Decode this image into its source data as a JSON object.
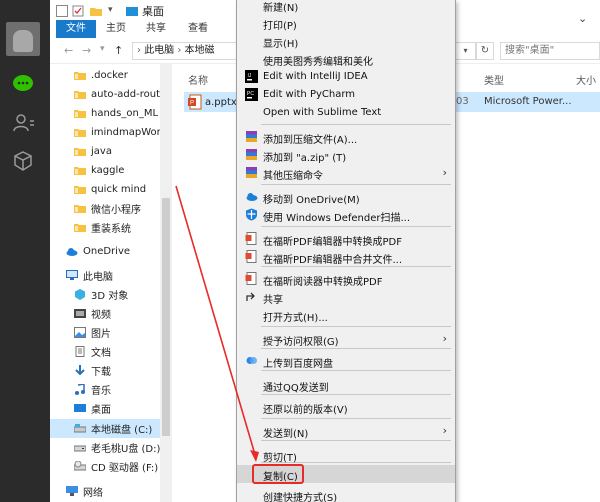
{
  "explorer": {
    "title": "桌面",
    "ribbon_tabs": {
      "file": "文件",
      "home": "主页",
      "share": "共享",
      "view": "查看"
    },
    "breadcrumb": [
      "此电脑",
      "本地磁"
    ],
    "search_placeholder": "搜索\"桌面\"",
    "columns": {
      "name": "名称",
      "type": "类型",
      "size": "大小"
    },
    "nav_items": [
      {
        "label": ".docker",
        "icon": "folder-icon"
      },
      {
        "label": "auto-add-route",
        "icon": "folder-icon"
      },
      {
        "label": "hands_on_ML",
        "icon": "folder-icon"
      },
      {
        "label": "imindmapWork",
        "icon": "folder-icon"
      },
      {
        "label": "java",
        "icon": "folder-icon"
      },
      {
        "label": "kaggle",
        "icon": "folder-icon"
      },
      {
        "label": "quick mind",
        "icon": "folder-icon"
      },
      {
        "label": "微信小程序",
        "icon": "folder-icon"
      },
      {
        "label": "重装系统",
        "icon": "folder-icon"
      },
      {
        "label": "OneDrive",
        "icon": "cloud-icon"
      },
      {
        "label": "此电脑",
        "icon": "computer-icon"
      },
      {
        "label": "3D 对象",
        "icon": "cube-icon"
      },
      {
        "label": "视频",
        "icon": "video-icon"
      },
      {
        "label": "图片",
        "icon": "picture-icon"
      },
      {
        "label": "文档",
        "icon": "document-icon"
      },
      {
        "label": "下载",
        "icon": "download-icon"
      },
      {
        "label": "音乐",
        "icon": "music-icon"
      },
      {
        "label": "桌面",
        "icon": "desktop-icon"
      },
      {
        "label": "本地磁盘 (C:)",
        "icon": "drive-icon"
      },
      {
        "label": "老毛桃U盘 (D:)",
        "icon": "usb-drive-icon"
      },
      {
        "label": "CD 驱动器 (F:)",
        "icon": "cd-drive-icon"
      },
      {
        "label": "网络",
        "icon": "network-icon"
      }
    ],
    "file": {
      "name": "a.pptx",
      "date_fragment": "03",
      "type": "Microsoft Power..."
    }
  },
  "context_menu": {
    "items": [
      {
        "label": "新建(N)",
        "icon": ""
      },
      {
        "label": "打印(P)",
        "icon": ""
      },
      {
        "label": "显示(H)",
        "icon": ""
      },
      {
        "label": "使用美图秀秀编辑和美化",
        "icon": ""
      },
      {
        "label": "Edit with IntelliJ IDEA",
        "icon": "intellij-icon"
      },
      {
        "label": "Edit with PyCharm",
        "icon": "pycharm-icon"
      },
      {
        "label": "Open with Sublime Text",
        "icon": ""
      },
      {
        "label": "添加到压缩文件(A)...",
        "icon": "winrar-icon"
      },
      {
        "label": "添加到 \"a.zip\" (T)",
        "icon": "winrar-icon"
      },
      {
        "label": "其他压缩命令",
        "icon": "winrar-icon",
        "submenu": true
      },
      {
        "label": "移动到 OneDrive(M)",
        "icon": "onedrive-icon"
      },
      {
        "label": "使用 Windows Defender扫描...",
        "icon": "defender-icon"
      },
      {
        "label": "在福昕PDF编辑器中转换成PDF",
        "icon": "foxit-icon"
      },
      {
        "label": "在福昕PDF编辑器中合并文件...",
        "icon": "foxit-icon"
      },
      {
        "label": "在福昕阅读器中转换成PDF",
        "icon": "foxit-icon"
      },
      {
        "label": "共享",
        "icon": "share-icon"
      },
      {
        "label": "打开方式(H)...",
        "icon": ""
      },
      {
        "label": "授予访问权限(G)",
        "icon": "",
        "submenu": true
      },
      {
        "label": "上传到百度网盘",
        "icon": "baidu-icon"
      },
      {
        "label": "通过QQ发送到",
        "icon": ""
      },
      {
        "label": "还原以前的版本(V)",
        "icon": ""
      },
      {
        "label": "发送到(N)",
        "icon": "",
        "submenu": true
      },
      {
        "label": "剪切(T)",
        "icon": ""
      },
      {
        "label": "复制(C)",
        "icon": "",
        "highlighted": true
      },
      {
        "label": "创建快捷方式(S)",
        "icon": ""
      }
    ]
  },
  "colors": {
    "accent": "#1979ca",
    "selection": "#cce8ff",
    "annotation": "#e82a2a"
  }
}
